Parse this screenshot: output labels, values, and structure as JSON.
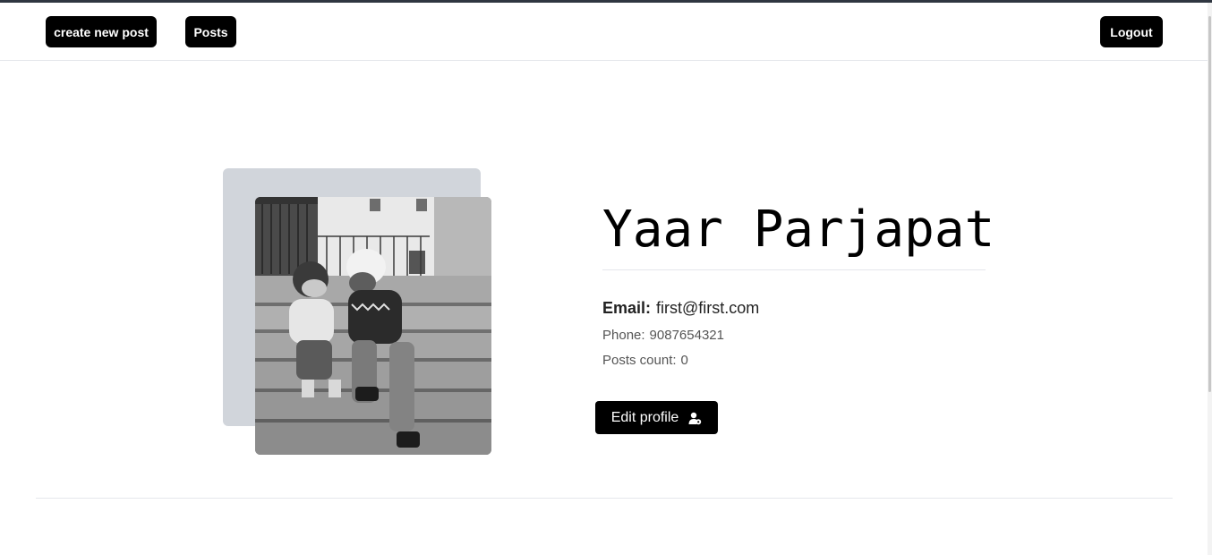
{
  "nav": {
    "create_post_label": "create new post",
    "posts_label": "Posts",
    "logout_label": "Logout"
  },
  "profile": {
    "name": "Yaar Parjapat",
    "email_label": "Email:",
    "email": "first@first.com",
    "phone_label": "Phone:",
    "phone": "9087654321",
    "posts_count_label": "Posts count:",
    "posts_count": "0",
    "edit_button_label": "Edit profile",
    "edit_button_icon": "user-edit-icon",
    "photo_alt": "profile-photo"
  },
  "colors": {
    "button_bg": "#000000",
    "button_text": "#ffffff",
    "photo_backdrop": "#d1d5db",
    "divider": "#e5e7eb"
  }
}
